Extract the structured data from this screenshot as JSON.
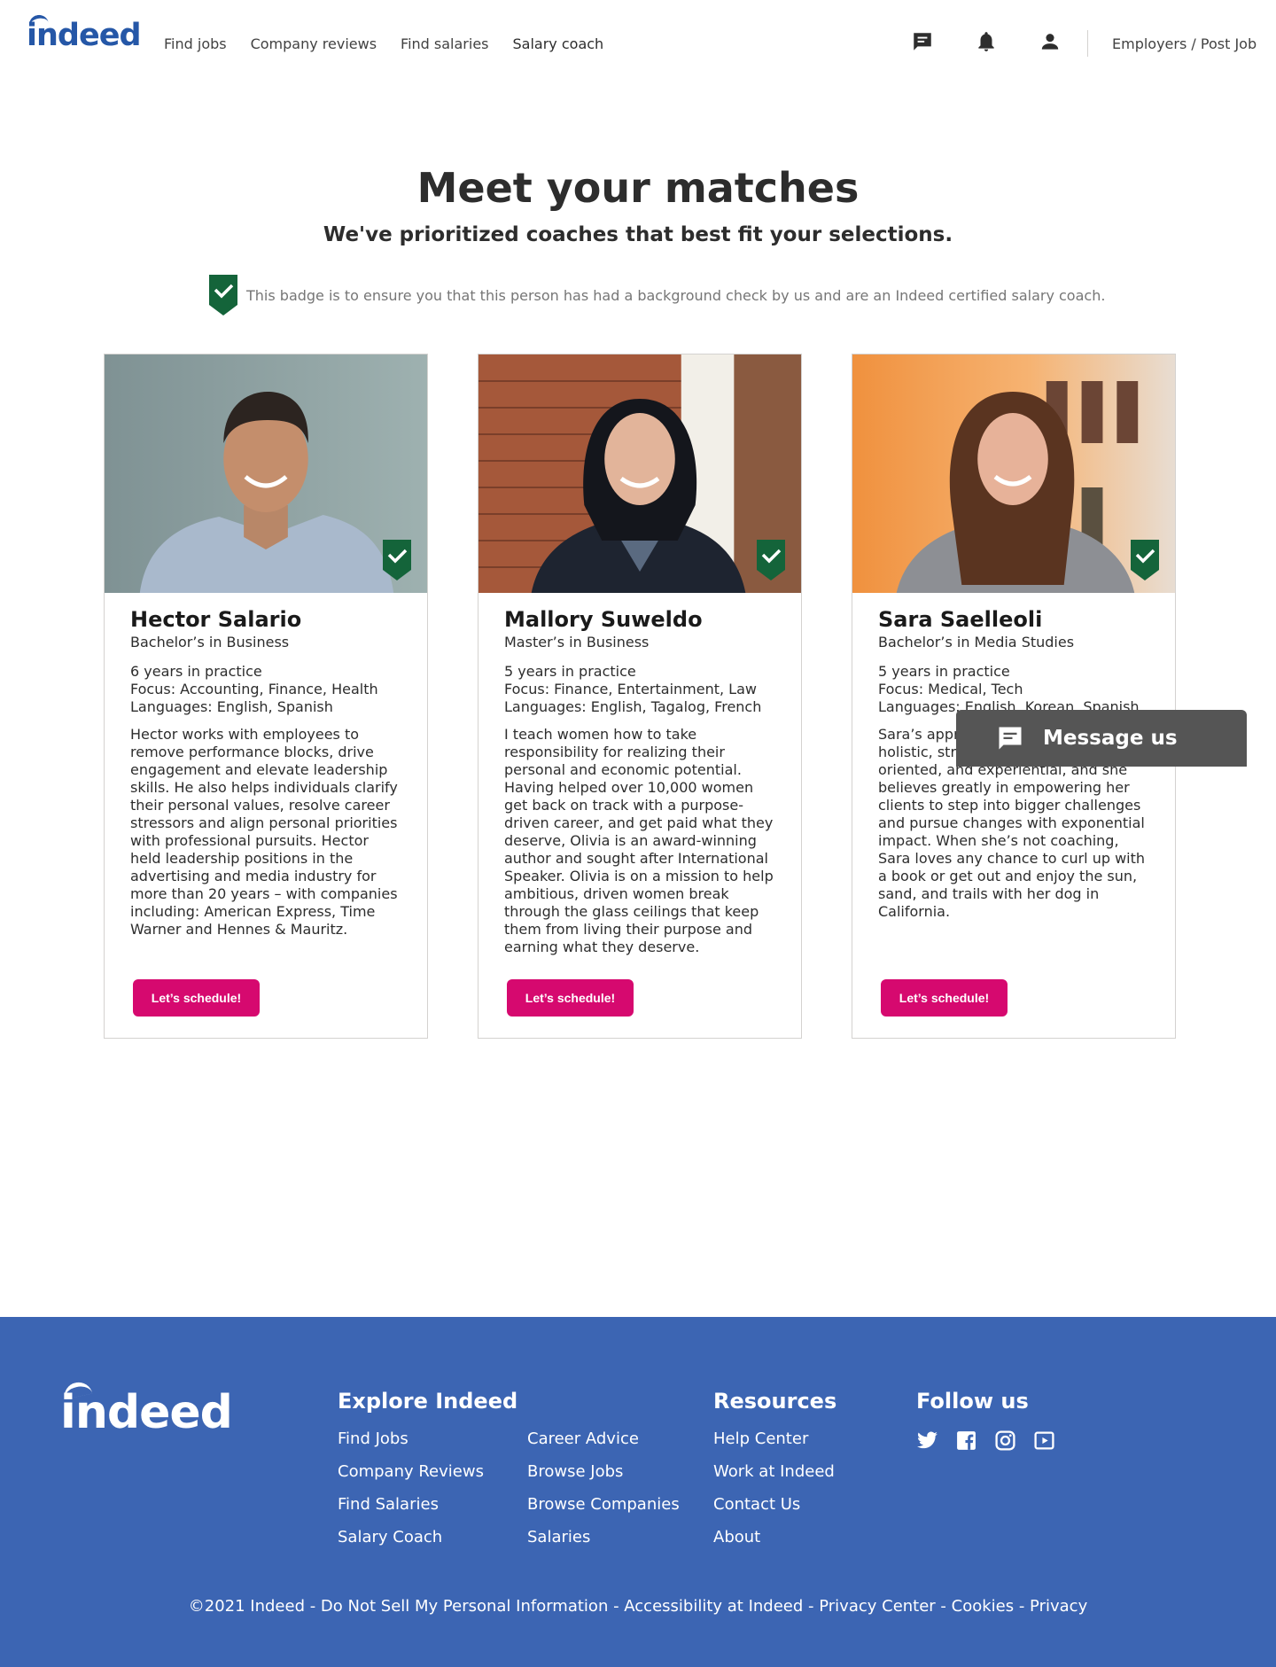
{
  "header": {
    "logo": "indeed",
    "nav": [
      "Find jobs",
      "Company reviews",
      "Find salaries",
      "Salary coach"
    ],
    "icons": [
      "messages-icon",
      "notifications-icon",
      "account-icon"
    ],
    "employers": "Employers / Post Job"
  },
  "intro": {
    "title": "Meet your matches",
    "subtitle": "We've prioritized coaches that best fit your selections.",
    "badge_note": "This badge is to ensure you that this person has had a background check by us and are an Indeed certified salary coach."
  },
  "coaches": [
    {
      "name": "Hector Salario",
      "degree": "Bachelor’s in Business",
      "practice": "6 years in practice",
      "focus": "Focus: Accounting, Finance, Health",
      "languages": "Languages: English, Spanish",
      "bio": "Hector works with employees to remove performance blocks, drive engagement and elevate leadership skills. He also helps individuals clarify their personal values, resolve career stressors and align personal priorities with professional pursuits. Hector held leadership positions in the advertising and media industry for more than 20 years – with companies including: American Express, Time Warner and Hennes & Mauritz.",
      "button": "Let’s schedule!"
    },
    {
      "name": "Mallory Suweldo",
      "degree": "Master’s in Business",
      "practice": "5 years in practice",
      "focus": "Focus: Finance, Entertainment, Law",
      "languages": "Languages: English, Tagalog, French",
      "bio": "I teach women how to take responsibility for realizing their personal and economic potential. Having helped over 10,000 women get back on track with a purpose-driven career, and get paid what they deserve, Olivia is an award-winning author and sought after International Speaker. Olivia is on a mission to help ambitious, driven women break through the glass ceilings that keep them from living their purpose and earning what they deserve.",
      "button": "Let’s schedule!"
    },
    {
      "name": "Sara Saelleoli",
      "degree": "Bachelor’s in Media Studies",
      "practice": "5 years in practice",
      "focus": "Focus: Medical, Tech",
      "languages": "Languages: English, Korean, Spanish",
      "bio": "Sara’s approach to coaching is holistic, strengths-based, goal-oriented, and experiential, and she believes greatly in empowering her clients to step into bigger challenges and pursue changes with exponential impact. When she’s not coaching, Sara loves any chance to curl up with a book or get out and enjoy the sun, sand, and trails with her dog in California.",
      "button": "Let’s schedule!"
    }
  ],
  "message_us": "Message us",
  "footer": {
    "logo": "indeed",
    "explore_heading": "Explore Indeed",
    "explore_col1": [
      "Find Jobs",
      "Company Reviews",
      "Find Salaries",
      "Salary Coach"
    ],
    "explore_col2": [
      "Career Advice",
      "Browse Jobs",
      "Browse Companies",
      "Salaries"
    ],
    "resources_heading": "Resources",
    "resources": [
      "Help Center",
      "Work at Indeed",
      "Contact Us",
      "About"
    ],
    "follow_heading": "Follow us",
    "social_icons": [
      "twitter-icon",
      "facebook-icon",
      "instagram-icon",
      "youtube-icon"
    ],
    "copyright": "©2021 Indeed - Do Not Sell My Personal Information - Accessibility at Indeed - Privacy Center - Cookies - Privacy"
  },
  "colors": {
    "brand_blue": "#2557a7",
    "footer_blue": "#3c65b3",
    "button_pink": "#d6096f",
    "badge_green": "#14643a"
  }
}
